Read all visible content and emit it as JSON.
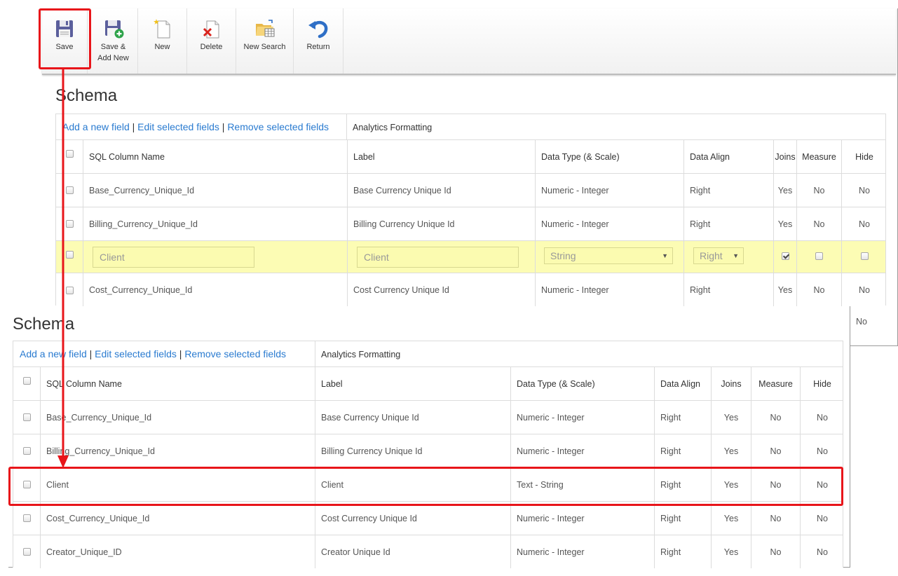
{
  "toolbar": {
    "save": "Save",
    "save_add_new_1": "Save &",
    "save_add_new_2": "Add New",
    "new": "New",
    "delete": "Delete",
    "new_search": "New Search",
    "return": "Return"
  },
  "schema_title": "Schema",
  "links": {
    "add": "Add a new field",
    "edit": "Edit selected fields",
    "remove": "Remove selected fields",
    "separator": "|",
    "analytics": "Analytics Formatting"
  },
  "columns": {
    "sql": "SQL Column Name",
    "label": "Label",
    "type": "Data Type (& Scale)",
    "align": "Data Align",
    "joins": "Joins",
    "measure": "Measure",
    "hide": "Hide"
  },
  "panel1_rows": [
    {
      "sql": "Base_Currency_Unique_Id",
      "label": "Base Currency Unique Id",
      "type": "Numeric - Integer",
      "align": "Right",
      "joins": "Yes",
      "measure": "No",
      "hide": "No"
    },
    {
      "sql": "Billing_Currency_Unique_Id",
      "label": "Billing Currency Unique Id",
      "type": "Numeric - Integer",
      "align": "Right",
      "joins": "Yes",
      "measure": "No",
      "hide": "No"
    },
    {
      "sql": "Cost_Currency_Unique_Id",
      "label": "Cost Currency Unique Id",
      "type": "Numeric - Integer",
      "align": "Right",
      "joins": "Yes",
      "measure": "No",
      "hide": "No"
    }
  ],
  "panel1_hidden_hide": "No",
  "edit_row": {
    "sql_value": "Client",
    "label_value": "Client",
    "type_value": "String",
    "align_value": "Right",
    "joins_checked": true,
    "measure_checked": false,
    "hide_checked": false
  },
  "panel2_rows": [
    {
      "sql": "Base_Currency_Unique_Id",
      "label": "Base Currency Unique Id",
      "type": "Numeric - Integer",
      "align": "Right",
      "joins": "Yes",
      "measure": "No",
      "hide": "No"
    },
    {
      "sql": "Billing_Currency_Unique_Id",
      "label": "Billing Currency Unique Id",
      "type": "Numeric - Integer",
      "align": "Right",
      "joins": "Yes",
      "measure": "No",
      "hide": "No"
    },
    {
      "sql": "Client",
      "label": "Client",
      "type": "Text - String",
      "align": "Right",
      "joins": "Yes",
      "measure": "No",
      "hide": "No"
    },
    {
      "sql": "Cost_Currency_Unique_Id",
      "label": "Cost Currency Unique Id",
      "type": "Numeric - Integer",
      "align": "Right",
      "joins": "Yes",
      "measure": "No",
      "hide": "No"
    },
    {
      "sql": "Creator_Unique_ID",
      "label": "Creator Unique Id",
      "type": "Numeric - Integer",
      "align": "Right",
      "joins": "Yes",
      "measure": "No",
      "hide": "No"
    }
  ],
  "colors": {
    "highlight": "#e8151a",
    "link": "#2a7bd0",
    "edit_row": "#fcfcb4"
  }
}
